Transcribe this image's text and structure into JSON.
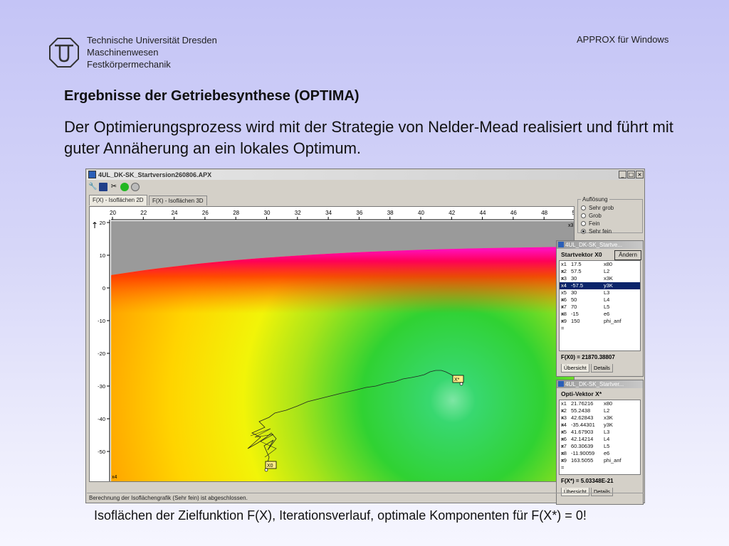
{
  "header": {
    "university": [
      "Technische Universität Dresden",
      "Maschinenwesen",
      "Festkörpermechanik"
    ],
    "app_name": "APPROX für Windows"
  },
  "slide": {
    "title": "Ergebnisse der Getriebesynthese (OPTIMA)",
    "description": "Der Optimierungsprozess wird mit der Strategie von Nelder-Mead realisiert und führt mit guter Annäherung an ein lokales Optimum.",
    "caption": "Isoflächen der Zielfunktion F(X), Iterationsverlauf, optimale Komponenten für F(X*) = 0!"
  },
  "window": {
    "title": "4UL_DK-SK_Startversion260806.APX",
    "buttons": [
      "_",
      "□",
      "×"
    ],
    "tabs": [
      "F(X) - Isoflächen 2D",
      "F(X) - Isoflächen 3D"
    ],
    "status": "Berechnung der Isoflächengrafik (Sehr fein) ist abgeschlossen."
  },
  "plot": {
    "x_ticks": [
      "20",
      "22",
      "24",
      "26",
      "28",
      "30",
      "32",
      "34",
      "36",
      "38",
      "40",
      "42",
      "44",
      "46",
      "48",
      "5"
    ],
    "x_axis_label": "x3",
    "y_ticks": [
      "20",
      "10",
      "0",
      "-10",
      "-20",
      "-30",
      "-40",
      "-50",
      "-60"
    ],
    "y_axis_label": "x4",
    "start_marker": "X0",
    "opt_marker": "X*"
  },
  "aufloesung": {
    "label": "Auflösung",
    "options": [
      {
        "label": "Sehr grob",
        "checked": false
      },
      {
        "label": "Grob",
        "checked": false
      },
      {
        "label": "Fein",
        "checked": false
      },
      {
        "label": "Sehr fein",
        "checked": true
      }
    ]
  },
  "startvektor": {
    "title": "4UL_DK-SK_Startve...",
    "header": "Startvektor X0",
    "button": "Ändern",
    "rows": [
      {
        "var": "x1 =",
        "val": "17.5",
        "name": "x80"
      },
      {
        "var": "x2 =",
        "val": "57.5",
        "name": "L2"
      },
      {
        "var": "x3 =",
        "val": "30",
        "name": "x3K"
      },
      {
        "var": "x4 =",
        "val": "-57.5",
        "name": "y3K",
        "selected": true
      },
      {
        "var": "x5 =",
        "val": "30",
        "name": "L3"
      },
      {
        "var": "x6 =",
        "val": "50",
        "name": "L4"
      },
      {
        "var": "x7 =",
        "val": "70",
        "name": "L5"
      },
      {
        "var": "x8 =",
        "val": "-15",
        "name": "e6"
      },
      {
        "var": "x9 =",
        "val": "150",
        "name": "phi_anf"
      }
    ],
    "f_value": "F(X0) = 21870.38807",
    "tabs": [
      "Übersicht",
      "Details"
    ]
  },
  "optivektor": {
    "title": "4UL_DK-SK_Startver...",
    "header": "Opti-Vektor X*",
    "rows": [
      {
        "var": "x1 =",
        "val": "21.76216",
        "name": "x80"
      },
      {
        "var": "x2 =",
        "val": "55.2438",
        "name": "L2"
      },
      {
        "var": "x3 =",
        "val": "42.62843",
        "name": "x3K"
      },
      {
        "var": "x4 =",
        "val": "-35.44301",
        "name": "y3K"
      },
      {
        "var": "x5 =",
        "val": "41.67903",
        "name": "L3"
      },
      {
        "var": "x6 =",
        "val": "42.14214",
        "name": "L4"
      },
      {
        "var": "x7 =",
        "val": "60.30639",
        "name": "L5"
      },
      {
        "var": "x8 =",
        "val": "-11.90059",
        "name": "e6"
      },
      {
        "var": "x9 =",
        "val": "163.5055",
        "name": "phi_anf"
      }
    ],
    "f_value": "F(X*) = 5.03348E-21",
    "tabs": [
      "Übersicht",
      "Details"
    ]
  }
}
